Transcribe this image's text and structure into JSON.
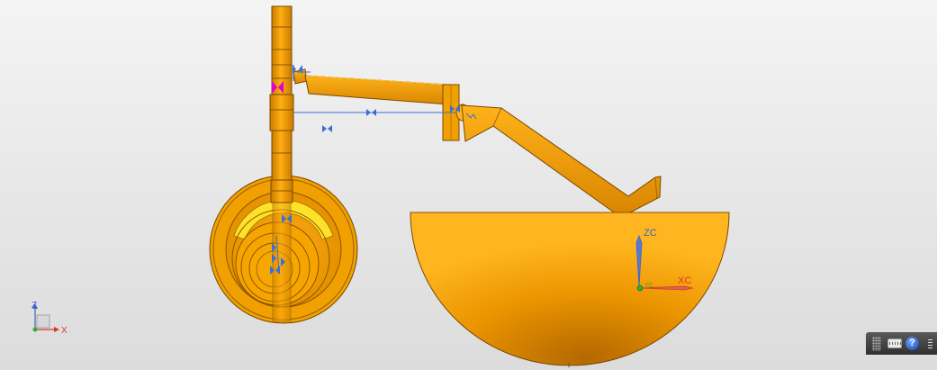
{
  "view_triad": {
    "z_label": "Z",
    "x_label": "X"
  },
  "wcs": {
    "zc_label": "ZC",
    "xc_label": "XC",
    "yc_label": "YC"
  },
  "colors": {
    "part": "#f5a000",
    "part_dark": "#b86e00",
    "constraint": "#3a6fd8",
    "selected_constraint": "#e000d0",
    "zc_axis": "#3b64c8",
    "xc_axis": "#d23a2a",
    "yc_axis": "#38a838"
  },
  "statusbar": {
    "icons": [
      "grip-icon",
      "keyboard-icon",
      "help-icon",
      "menu-icon"
    ],
    "help_glyph": "?"
  }
}
